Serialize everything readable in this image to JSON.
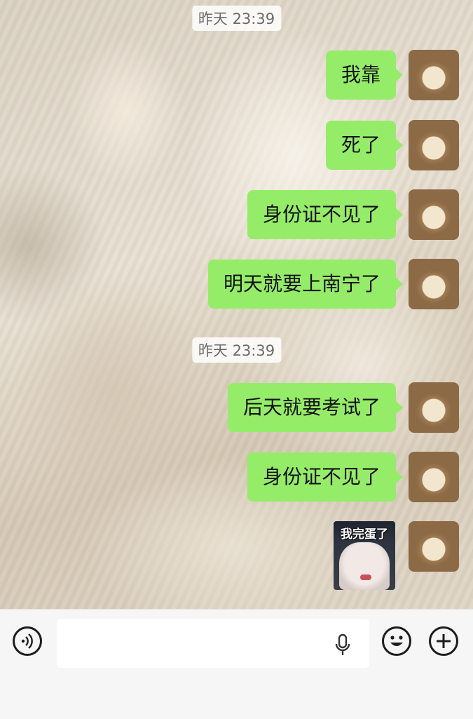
{
  "chat": {
    "timestamps": [
      "昨天 23:39",
      "昨天 23:39"
    ],
    "messages": [
      {
        "type": "text",
        "text": "我靠"
      },
      {
        "type": "text",
        "text": "死了"
      },
      {
        "type": "text",
        "text": "身份证不见了"
      },
      {
        "type": "text",
        "text": "明天就要上南宁了"
      },
      {
        "type": "text",
        "text": "后天就要考试了"
      },
      {
        "type": "text",
        "text": "身份证不见了"
      },
      {
        "type": "sticker",
        "caption": "我完蛋了"
      }
    ]
  },
  "input_bar": {
    "voice_icon": "voice-icon",
    "mic_icon": "microphone-icon",
    "emoji_icon": "emoji-icon",
    "plus_icon": "plus-icon",
    "text_value": ""
  },
  "colors": {
    "bubble_outgoing": "#95ec69",
    "timestamp_bg": "#ffffff",
    "input_bar_bg": "#f6f6f6"
  }
}
